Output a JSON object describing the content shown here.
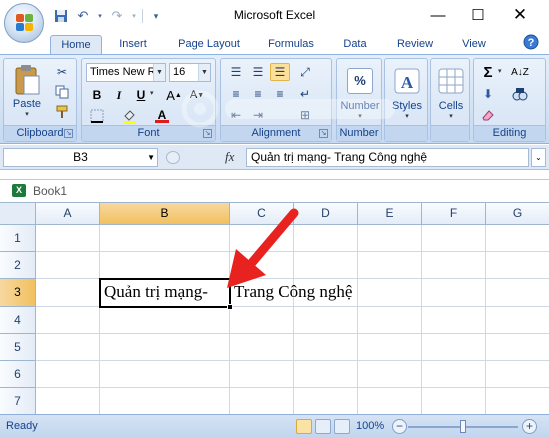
{
  "window": {
    "title": "Microsoft Excel",
    "controls": [
      "minimize",
      "maximize",
      "close"
    ]
  },
  "quick_access": {
    "items": [
      "save-icon",
      "undo-icon",
      "redo-icon",
      "customize-icon"
    ]
  },
  "ribbon": {
    "tabs": [
      "Home",
      "Insert",
      "Page Layout",
      "Formulas",
      "Data",
      "Review",
      "View"
    ],
    "active_tab": "Home",
    "clipboard": {
      "label": "Clipboard",
      "paste": "Paste"
    },
    "font": {
      "label": "Font",
      "name": "Times New Ro",
      "size": "16"
    },
    "alignment": {
      "label": "Alignment"
    },
    "number": {
      "label": "Number",
      "symbol": "%"
    },
    "styles": {
      "label": "Styles"
    },
    "cells": {
      "label": "Cells"
    },
    "editing": {
      "label": "Editing"
    }
  },
  "formula_bar": {
    "name_box": "B3",
    "fx": "fx",
    "content": "Quản trị mạng- Trang Công nghệ"
  },
  "workbook": {
    "title": "Book1",
    "columns": [
      "A",
      "B",
      "C",
      "D",
      "E",
      "F",
      "G"
    ],
    "rows": [
      "1",
      "2",
      "3",
      "4",
      "5",
      "6",
      "7"
    ],
    "selected_column": "B",
    "selected_row": "3",
    "cell_B3": "Quản trị mạng-",
    "cell_C3_overflow": "Trang Công nghệ"
  },
  "status_bar": {
    "status": "Ready",
    "zoom": "100%",
    "zoom_level": 1.0
  },
  "colors": {
    "ribbon_blue": "#dfe9f5",
    "selected_header": "#f1c15f",
    "arrow_red": "#e8231f"
  }
}
